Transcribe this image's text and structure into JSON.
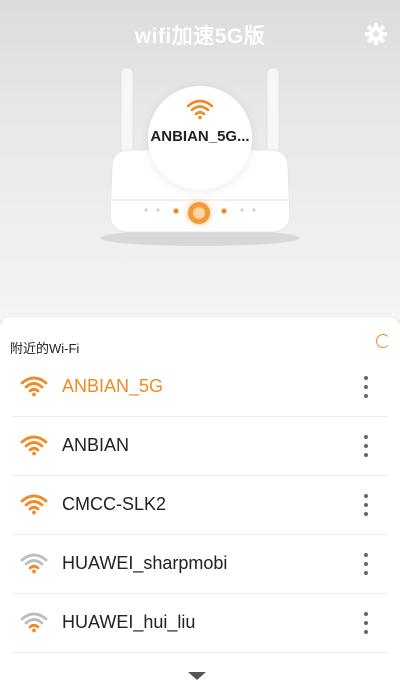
{
  "header": {
    "title": "wifi加速5G版",
    "settings_icon": "gear-icon"
  },
  "router": {
    "connected_ssid": "ANBIAN_5G...",
    "wifi_icon": "wifi-icon"
  },
  "nearby": {
    "section_title": "附近的Wi-Fi",
    "refresh_icon": "refresh-icon",
    "networks": [
      {
        "name": "ANBIAN_5G",
        "signal": "strong",
        "active": true
      },
      {
        "name": "ANBIAN",
        "signal": "strong",
        "active": false
      },
      {
        "name": "CMCC-SLK2",
        "signal": "strong",
        "active": false
      },
      {
        "name": "HUAWEI_sharpmobi",
        "signal": "weak",
        "active": false
      },
      {
        "name": "HUAWEI_hui_liu",
        "signal": "weak",
        "active": false
      }
    ],
    "more_icon": "more-vertical-icon",
    "expand_icon": "chevron-down-icon"
  },
  "colors": {
    "accent": "#f08a24",
    "text": "#222222",
    "weak_signal": "#bdbdbd"
  }
}
